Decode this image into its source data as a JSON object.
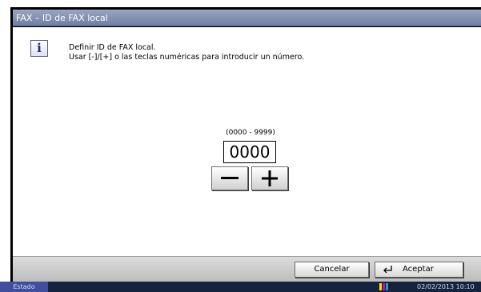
{
  "window": {
    "title": "FAX – ID de FAX local"
  },
  "message": {
    "icon": "info-icon",
    "line1": "Definir ID de FAX local.",
    "line2": "Usar [-]/[+] o las teclas numéricas para introducir un número."
  },
  "input": {
    "range": "(0000 - 9999)",
    "value": "0000",
    "minus_icon": "minus-icon",
    "plus_icon": "plus-icon"
  },
  "buttons": {
    "cancel": "Cancelar",
    "accept": "Aceptar",
    "accept_icon": "enter-icon"
  },
  "status": {
    "tab": "Estado",
    "datetime": "02/02/2013  10:10",
    "toner_colors": [
      "#e8e800",
      "#e000a0",
      "#00a8e0",
      "#202020"
    ]
  },
  "colors": {
    "titlebar": "#7c8aad",
    "statusbar": "#15233f",
    "status_tab": "#3f4f9e"
  }
}
